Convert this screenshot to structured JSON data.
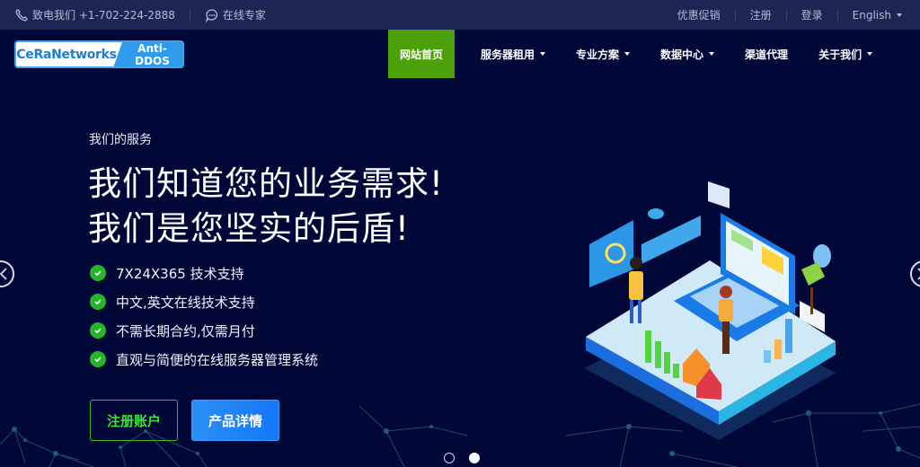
{
  "topbar": {
    "phone_label": "致电我们 +1-702-224-2888",
    "chat_label": "在线专家",
    "links": [
      "优惠促销",
      "注册",
      "登录"
    ],
    "language": "English"
  },
  "logo": {
    "brand": "CeRaNetworks",
    "tag": "Anti-DDOS"
  },
  "nav": {
    "items": [
      {
        "label": "网站首页",
        "active": true,
        "dropdown": false
      },
      {
        "label": "服务器租用",
        "active": false,
        "dropdown": true
      },
      {
        "label": "专业方案",
        "active": false,
        "dropdown": true
      },
      {
        "label": "数据中心",
        "active": false,
        "dropdown": true
      },
      {
        "label": "渠道代理",
        "active": false,
        "dropdown": false
      },
      {
        "label": "关于我们",
        "active": false,
        "dropdown": true
      }
    ]
  },
  "hero": {
    "eyebrow": "我们的服务",
    "headline_line1": "我们知道您的业务需求!",
    "headline_line2": "我们是您坚实的后盾!",
    "features": [
      "7X24X365 技术支持",
      "中文,英文在线技术支持",
      "不需长期合约,仅需月付",
      "直观与简便的在线服务器管理系统"
    ],
    "register_button": "注册账户",
    "details_button": "产品详情"
  },
  "carousel": {
    "slide_count": 2,
    "active_slide": 2
  },
  "colors": {
    "background": "#010838",
    "topbar": "#1d2653",
    "nav_active": "#4ca10a",
    "check_green": "#25b52a",
    "primary_blue": "#1e88f6"
  }
}
